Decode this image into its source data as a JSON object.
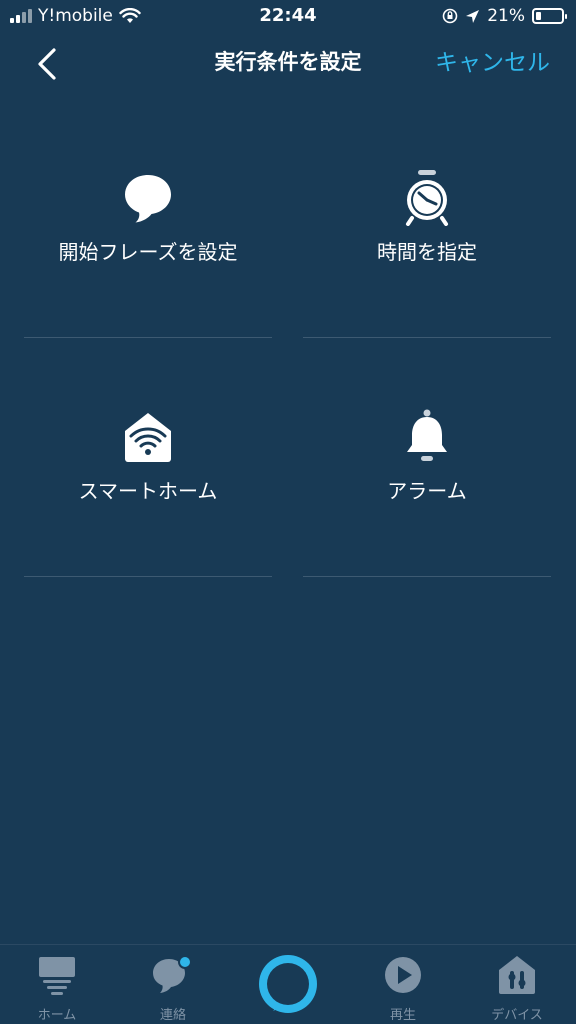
{
  "status_bar": {
    "carrier": "Y!mobile",
    "time": "22:44",
    "battery_percent": "21%",
    "battery_level": 0.21
  },
  "nav": {
    "title": "実行条件を設定",
    "cancel_label": "キャンセル"
  },
  "options": [
    {
      "label": "開始フレーズを設定",
      "icon": "speech-bubble-icon"
    },
    {
      "label": "時間を指定",
      "icon": "alarm-clock-icon"
    },
    {
      "label": "スマートホーム",
      "icon": "smart-home-icon"
    },
    {
      "label": "アラーム",
      "icon": "bell-icon"
    }
  ],
  "tabs": [
    {
      "label": "ホーム",
      "icon": "home-icon"
    },
    {
      "label": "連絡",
      "icon": "chat-icon",
      "has_notification": true
    },
    {
      "label": "",
      "icon": "alexa-ring-icon"
    },
    {
      "label": "再生",
      "icon": "play-icon"
    },
    {
      "label": "デバイス",
      "icon": "devices-icon"
    }
  ],
  "colors": {
    "background": "#183a55",
    "accent": "#2fb6ea",
    "tab_inactive": "#7f93a6",
    "divider": "#3d5a72"
  }
}
